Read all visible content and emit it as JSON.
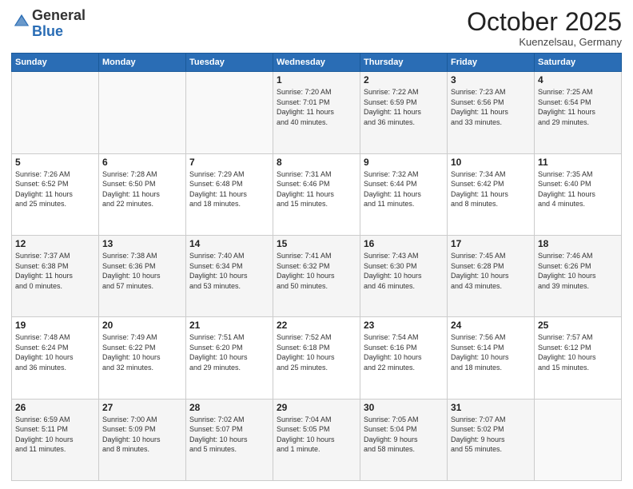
{
  "header": {
    "logo": {
      "line1": "General",
      "line2": "Blue"
    },
    "month": "October 2025",
    "location": "Kuenzelsau, Germany"
  },
  "weekdays": [
    "Sunday",
    "Monday",
    "Tuesday",
    "Wednesday",
    "Thursday",
    "Friday",
    "Saturday"
  ],
  "weeks": [
    [
      {
        "day": "",
        "info": ""
      },
      {
        "day": "",
        "info": ""
      },
      {
        "day": "",
        "info": ""
      },
      {
        "day": "1",
        "info": "Sunrise: 7:20 AM\nSunset: 7:01 PM\nDaylight: 11 hours\nand 40 minutes."
      },
      {
        "day": "2",
        "info": "Sunrise: 7:22 AM\nSunset: 6:59 PM\nDaylight: 11 hours\nand 36 minutes."
      },
      {
        "day": "3",
        "info": "Sunrise: 7:23 AM\nSunset: 6:56 PM\nDaylight: 11 hours\nand 33 minutes."
      },
      {
        "day": "4",
        "info": "Sunrise: 7:25 AM\nSunset: 6:54 PM\nDaylight: 11 hours\nand 29 minutes."
      }
    ],
    [
      {
        "day": "5",
        "info": "Sunrise: 7:26 AM\nSunset: 6:52 PM\nDaylight: 11 hours\nand 25 minutes."
      },
      {
        "day": "6",
        "info": "Sunrise: 7:28 AM\nSunset: 6:50 PM\nDaylight: 11 hours\nand 22 minutes."
      },
      {
        "day": "7",
        "info": "Sunrise: 7:29 AM\nSunset: 6:48 PM\nDaylight: 11 hours\nand 18 minutes."
      },
      {
        "day": "8",
        "info": "Sunrise: 7:31 AM\nSunset: 6:46 PM\nDaylight: 11 hours\nand 15 minutes."
      },
      {
        "day": "9",
        "info": "Sunrise: 7:32 AM\nSunset: 6:44 PM\nDaylight: 11 hours\nand 11 minutes."
      },
      {
        "day": "10",
        "info": "Sunrise: 7:34 AM\nSunset: 6:42 PM\nDaylight: 11 hours\nand 8 minutes."
      },
      {
        "day": "11",
        "info": "Sunrise: 7:35 AM\nSunset: 6:40 PM\nDaylight: 11 hours\nand 4 minutes."
      }
    ],
    [
      {
        "day": "12",
        "info": "Sunrise: 7:37 AM\nSunset: 6:38 PM\nDaylight: 11 hours\nand 0 minutes."
      },
      {
        "day": "13",
        "info": "Sunrise: 7:38 AM\nSunset: 6:36 PM\nDaylight: 10 hours\nand 57 minutes."
      },
      {
        "day": "14",
        "info": "Sunrise: 7:40 AM\nSunset: 6:34 PM\nDaylight: 10 hours\nand 53 minutes."
      },
      {
        "day": "15",
        "info": "Sunrise: 7:41 AM\nSunset: 6:32 PM\nDaylight: 10 hours\nand 50 minutes."
      },
      {
        "day": "16",
        "info": "Sunrise: 7:43 AM\nSunset: 6:30 PM\nDaylight: 10 hours\nand 46 minutes."
      },
      {
        "day": "17",
        "info": "Sunrise: 7:45 AM\nSunset: 6:28 PM\nDaylight: 10 hours\nand 43 minutes."
      },
      {
        "day": "18",
        "info": "Sunrise: 7:46 AM\nSunset: 6:26 PM\nDaylight: 10 hours\nand 39 minutes."
      }
    ],
    [
      {
        "day": "19",
        "info": "Sunrise: 7:48 AM\nSunset: 6:24 PM\nDaylight: 10 hours\nand 36 minutes."
      },
      {
        "day": "20",
        "info": "Sunrise: 7:49 AM\nSunset: 6:22 PM\nDaylight: 10 hours\nand 32 minutes."
      },
      {
        "day": "21",
        "info": "Sunrise: 7:51 AM\nSunset: 6:20 PM\nDaylight: 10 hours\nand 29 minutes."
      },
      {
        "day": "22",
        "info": "Sunrise: 7:52 AM\nSunset: 6:18 PM\nDaylight: 10 hours\nand 25 minutes."
      },
      {
        "day": "23",
        "info": "Sunrise: 7:54 AM\nSunset: 6:16 PM\nDaylight: 10 hours\nand 22 minutes."
      },
      {
        "day": "24",
        "info": "Sunrise: 7:56 AM\nSunset: 6:14 PM\nDaylight: 10 hours\nand 18 minutes."
      },
      {
        "day": "25",
        "info": "Sunrise: 7:57 AM\nSunset: 6:12 PM\nDaylight: 10 hours\nand 15 minutes."
      }
    ],
    [
      {
        "day": "26",
        "info": "Sunrise: 6:59 AM\nSunset: 5:11 PM\nDaylight: 10 hours\nand 11 minutes."
      },
      {
        "day": "27",
        "info": "Sunrise: 7:00 AM\nSunset: 5:09 PM\nDaylight: 10 hours\nand 8 minutes."
      },
      {
        "day": "28",
        "info": "Sunrise: 7:02 AM\nSunset: 5:07 PM\nDaylight: 10 hours\nand 5 minutes."
      },
      {
        "day": "29",
        "info": "Sunrise: 7:04 AM\nSunset: 5:05 PM\nDaylight: 10 hours\nand 1 minute."
      },
      {
        "day": "30",
        "info": "Sunrise: 7:05 AM\nSunset: 5:04 PM\nDaylight: 9 hours\nand 58 minutes."
      },
      {
        "day": "31",
        "info": "Sunrise: 7:07 AM\nSunset: 5:02 PM\nDaylight: 9 hours\nand 55 minutes."
      },
      {
        "day": "",
        "info": ""
      }
    ]
  ]
}
